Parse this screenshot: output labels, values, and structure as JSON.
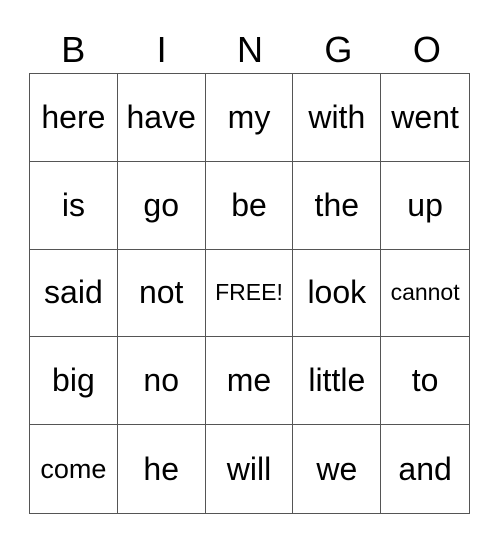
{
  "header": [
    "B",
    "I",
    "N",
    "G",
    "O"
  ],
  "cells": [
    "here",
    "have",
    "my",
    "with",
    "went",
    "is",
    "go",
    "be",
    "the",
    "up",
    "said",
    "not",
    "FREE!",
    "look",
    "cannot",
    "big",
    "no",
    "me",
    "little",
    "to",
    "come",
    "he",
    "will",
    "we",
    "and"
  ],
  "free_space": "FREE!"
}
